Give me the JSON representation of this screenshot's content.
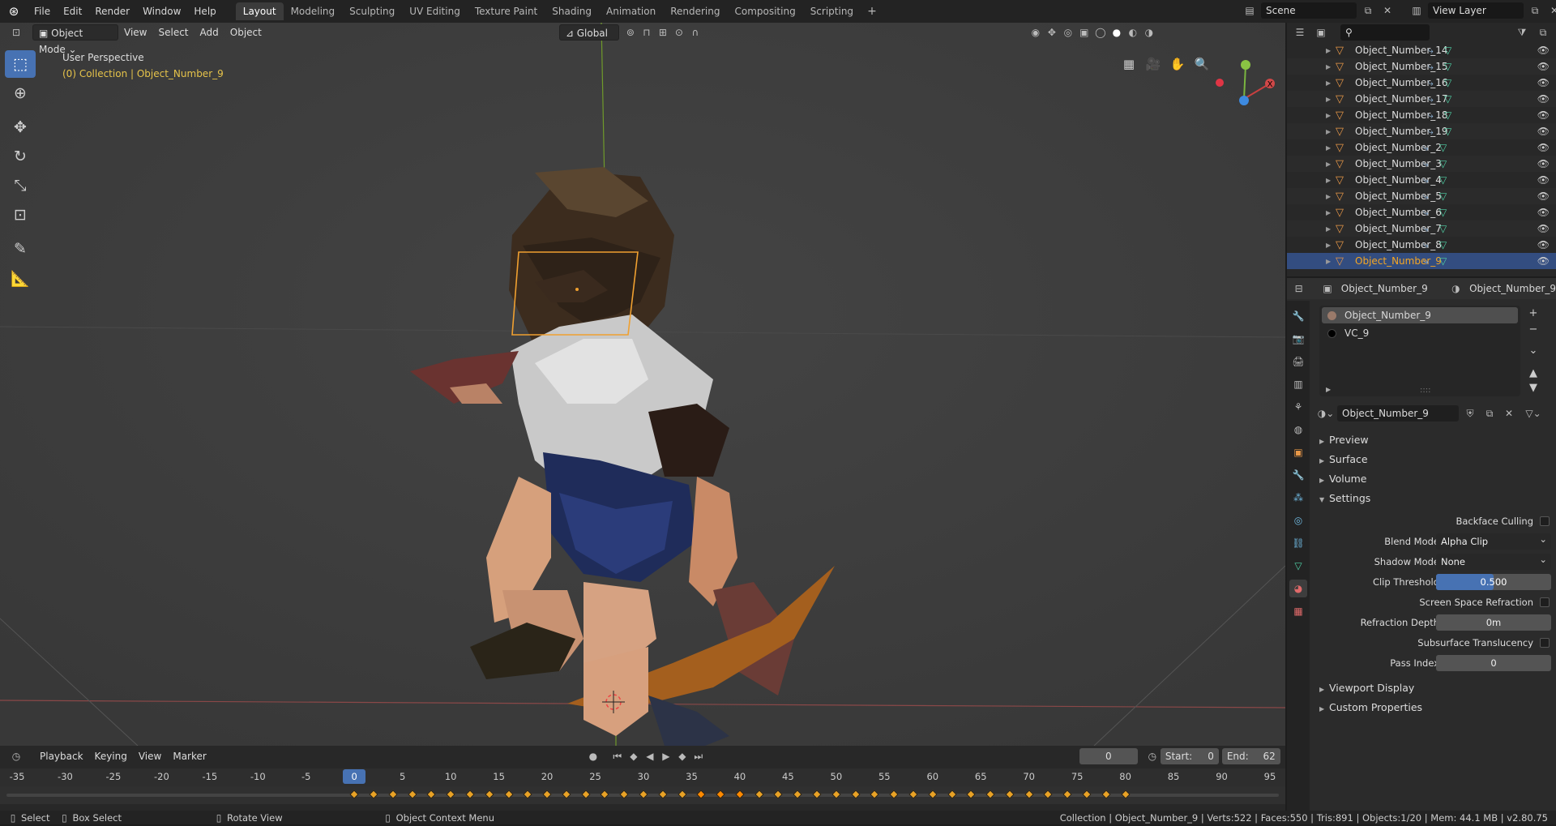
{
  "menu": [
    "File",
    "Edit",
    "Render",
    "Window",
    "Help"
  ],
  "workspaces": [
    "Layout",
    "Modeling",
    "Sculpting",
    "UV Editing",
    "Texture Paint",
    "Shading",
    "Animation",
    "Rendering",
    "Compositing",
    "Scripting"
  ],
  "active_workspace": "Layout",
  "scene_name": "Scene",
  "view_layer": "View Layer",
  "viewport": {
    "mode": "Object Mode",
    "menus": [
      "View",
      "Select",
      "Add",
      "Object"
    ],
    "orientation": "Global",
    "perspective_label": "User Perspective",
    "collection_label": "(0) Collection | Object_Number_9"
  },
  "outliner": {
    "search_placeholder": "",
    "rows": [
      "Object_Number_14",
      "Object_Number_15",
      "Object_Number_16",
      "Object_Number_17",
      "Object_Number_18",
      "Object_Number_19",
      "Object_Number_2",
      "Object_Number_3",
      "Object_Number_4",
      "Object_Number_5",
      "Object_Number_6",
      "Object_Number_7",
      "Object_Number_8",
      "Object_Number_9"
    ],
    "selected": "Object_Number_9"
  },
  "properties": {
    "object_name": "Object_Number_9",
    "material_name": "Object_Number_9",
    "slots": [
      {
        "name": "Object_Number_9",
        "color": "#9a7a6a"
      },
      {
        "name": "VC_9",
        "color": "#000000"
      }
    ],
    "material_field": "Object_Number_9",
    "panels": {
      "preview": "Preview",
      "surface": "Surface",
      "volume": "Volume",
      "settings": "Settings",
      "viewport_display": "Viewport Display",
      "custom_properties": "Custom Properties"
    },
    "settings": {
      "backface_culling_label": "Backface Culling",
      "blend_mode_label": "Blend Mode",
      "blend_mode": "Alpha Clip",
      "shadow_mode_label": "Shadow Mode",
      "shadow_mode": "None",
      "clip_threshold_label": "Clip Threshold",
      "clip_threshold": "0.500",
      "clip_fraction": 0.5,
      "ssr_label": "Screen Space Refraction",
      "refraction_depth_label": "Refraction Depth",
      "refraction_depth": "0m",
      "sss_label": "Subsurface Translucency",
      "pass_index_label": "Pass Index",
      "pass_index": "0"
    }
  },
  "timeline": {
    "menus": [
      "Playback",
      "Keying",
      "View",
      "Marker"
    ],
    "current_frame": "0",
    "start_label": "Start:",
    "start": "0",
    "end_label": "End:",
    "end": "62",
    "ruler": [
      "-35",
      "-30",
      "-25",
      "-20",
      "-15",
      "-10",
      "-5",
      "0",
      "5",
      "10",
      "15",
      "20",
      "25",
      "30",
      "35",
      "40",
      "45",
      "50",
      "55",
      "60",
      "65",
      "70",
      "75",
      "80",
      "85",
      "90",
      "95"
    ],
    "ruler_values": [
      -35,
      -30,
      -25,
      -20,
      -15,
      -10,
      -5,
      0,
      5,
      10,
      15,
      20,
      25,
      30,
      35,
      40,
      45,
      50,
      55,
      60,
      65,
      70,
      75,
      80,
      85,
      90,
      95
    ]
  },
  "status": {
    "select": "Select",
    "box_select": "Box Select",
    "rotate_view": "Rotate View",
    "context_menu": "Object Context Menu",
    "stats": "Collection | Object_Number_9 | Verts:522 | Faces:550 | Tris:891 | Objects:1/20 | Mem: 44.1 MB | v2.80.75"
  }
}
